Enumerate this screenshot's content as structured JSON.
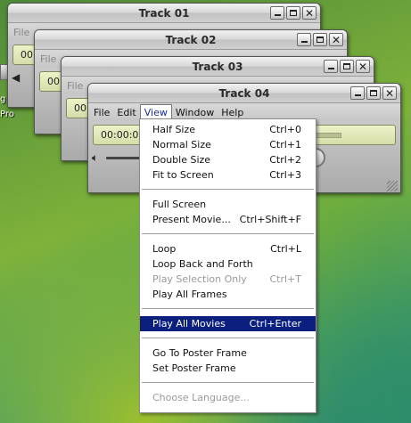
{
  "desktop": {
    "side_texts": [
      "g",
      "Pro"
    ]
  },
  "windows": [
    {
      "title": "Track 01",
      "menu": "File",
      "time": "00"
    },
    {
      "title": "Track 02",
      "menu": "File",
      "time": "00"
    },
    {
      "title": "Track 03",
      "menu": "File",
      "time": "00"
    },
    {
      "title": "Track 04",
      "menu_items": [
        "File",
        "Edit",
        "View",
        "Window",
        "Help"
      ],
      "active_menu": "View",
      "time": "00:00:00"
    }
  ],
  "view_menu": {
    "groups": [
      [
        {
          "label": "Half Size",
          "shortcut": "Ctrl+0"
        },
        {
          "label": "Normal Size",
          "shortcut": "Ctrl+1"
        },
        {
          "label": "Double Size",
          "shortcut": "Ctrl+2"
        },
        {
          "label": "Fit to Screen",
          "shortcut": "Ctrl+3"
        }
      ],
      [
        {
          "label": "Full Screen",
          "shortcut": ""
        },
        {
          "label": "Present Movie...",
          "shortcut": "Ctrl+Shift+F"
        }
      ],
      [
        {
          "label": "Loop",
          "shortcut": "Ctrl+L"
        },
        {
          "label": "Loop Back and Forth",
          "shortcut": ""
        },
        {
          "label": "Play Selection Only",
          "shortcut": "Ctrl+T",
          "disabled": true
        },
        {
          "label": "Play All Frames",
          "shortcut": ""
        }
      ],
      [
        {
          "label": "Play All Movies",
          "shortcut": "Ctrl+Enter",
          "highlighted": true
        }
      ],
      [
        {
          "label": "Go To Poster Frame",
          "shortcut": ""
        },
        {
          "label": "Set Poster Frame",
          "shortcut": ""
        }
      ],
      [
        {
          "label": "Choose Language...",
          "shortcut": "",
          "disabled": true
        }
      ]
    ]
  },
  "colors": {
    "highlight": "#0a1f7e",
    "lcd": "#e2e8b8"
  },
  "icons": {
    "minimize": "minimize-icon",
    "maximize": "maximize-icon",
    "close": "close-icon",
    "volume": "speaker-icon"
  }
}
